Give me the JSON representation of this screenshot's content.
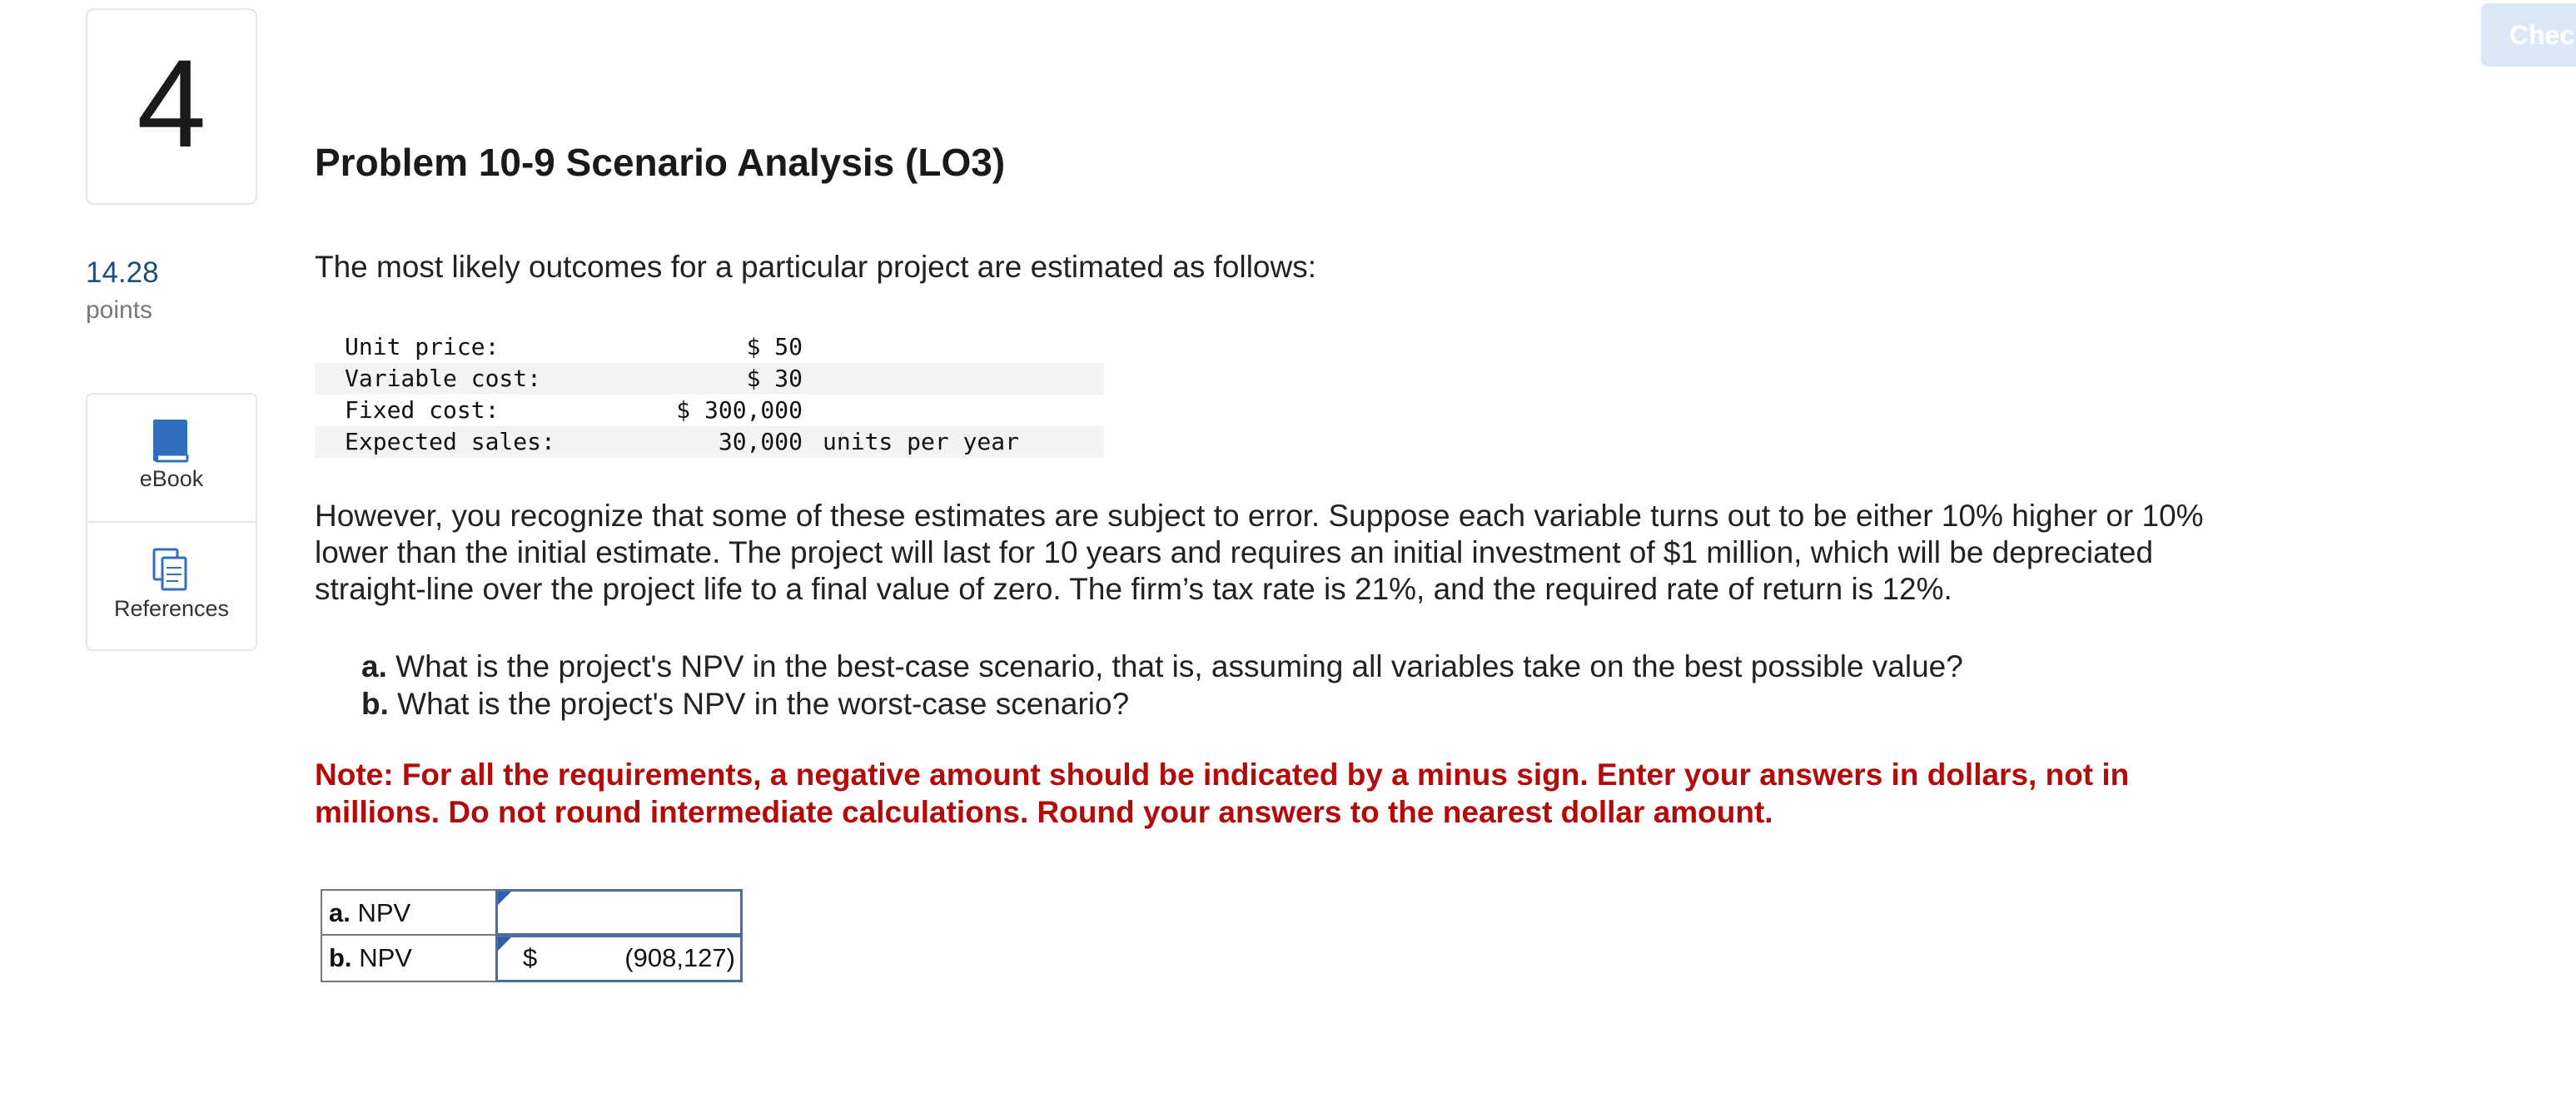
{
  "question": {
    "number": "4",
    "points_value": "14.28",
    "points_label": "points"
  },
  "tools": {
    "ebook_label": "eBook",
    "references_label": "References"
  },
  "check_button": {
    "label": "Check"
  },
  "problem": {
    "title": "Problem 10-9 Scenario Analysis (LO3)",
    "intro": "The most likely outcomes for a particular project are estimated as follows:",
    "estimates": [
      {
        "label": "Unit price:",
        "value": "$ 50",
        "unit": ""
      },
      {
        "label": "Variable cost:",
        "value": "$ 30",
        "unit": ""
      },
      {
        "label": "Fixed cost:",
        "value": "$ 300,000",
        "unit": ""
      },
      {
        "label": "Expected sales:",
        "value": "30,000",
        "unit": "units per year"
      }
    ],
    "paragraph": "However, you recognize that some of these estimates are subject to error. Suppose each variable turns out to be either 10% higher or 10% lower than the initial estimate. The project will last for 10 years and requires an initial investment of $1 million, which will be depreciated straight-line over the project life to a final value of zero. The firm’s tax rate is 21%, and the required rate of return is 12%.",
    "questions": [
      {
        "letter": "a.",
        "text": "What is the project's NPV in the best-case scenario, that is, assuming all variables take on the best possible value?"
      },
      {
        "letter": "b.",
        "text": "What is the project's NPV in the worst-case scenario?"
      }
    ],
    "note": "Note: For all the requirements, a negative amount should be indicated by a minus sign. Enter your answers in dollars, not in millions. Do not round intermediate calculations. Round your answers to the nearest dollar amount."
  },
  "answers": [
    {
      "letter": "a.",
      "label": "NPV",
      "currency": "",
      "value": ""
    },
    {
      "letter": "b.",
      "label": "NPV",
      "currency": "$",
      "value": "(908,127)"
    }
  ]
}
